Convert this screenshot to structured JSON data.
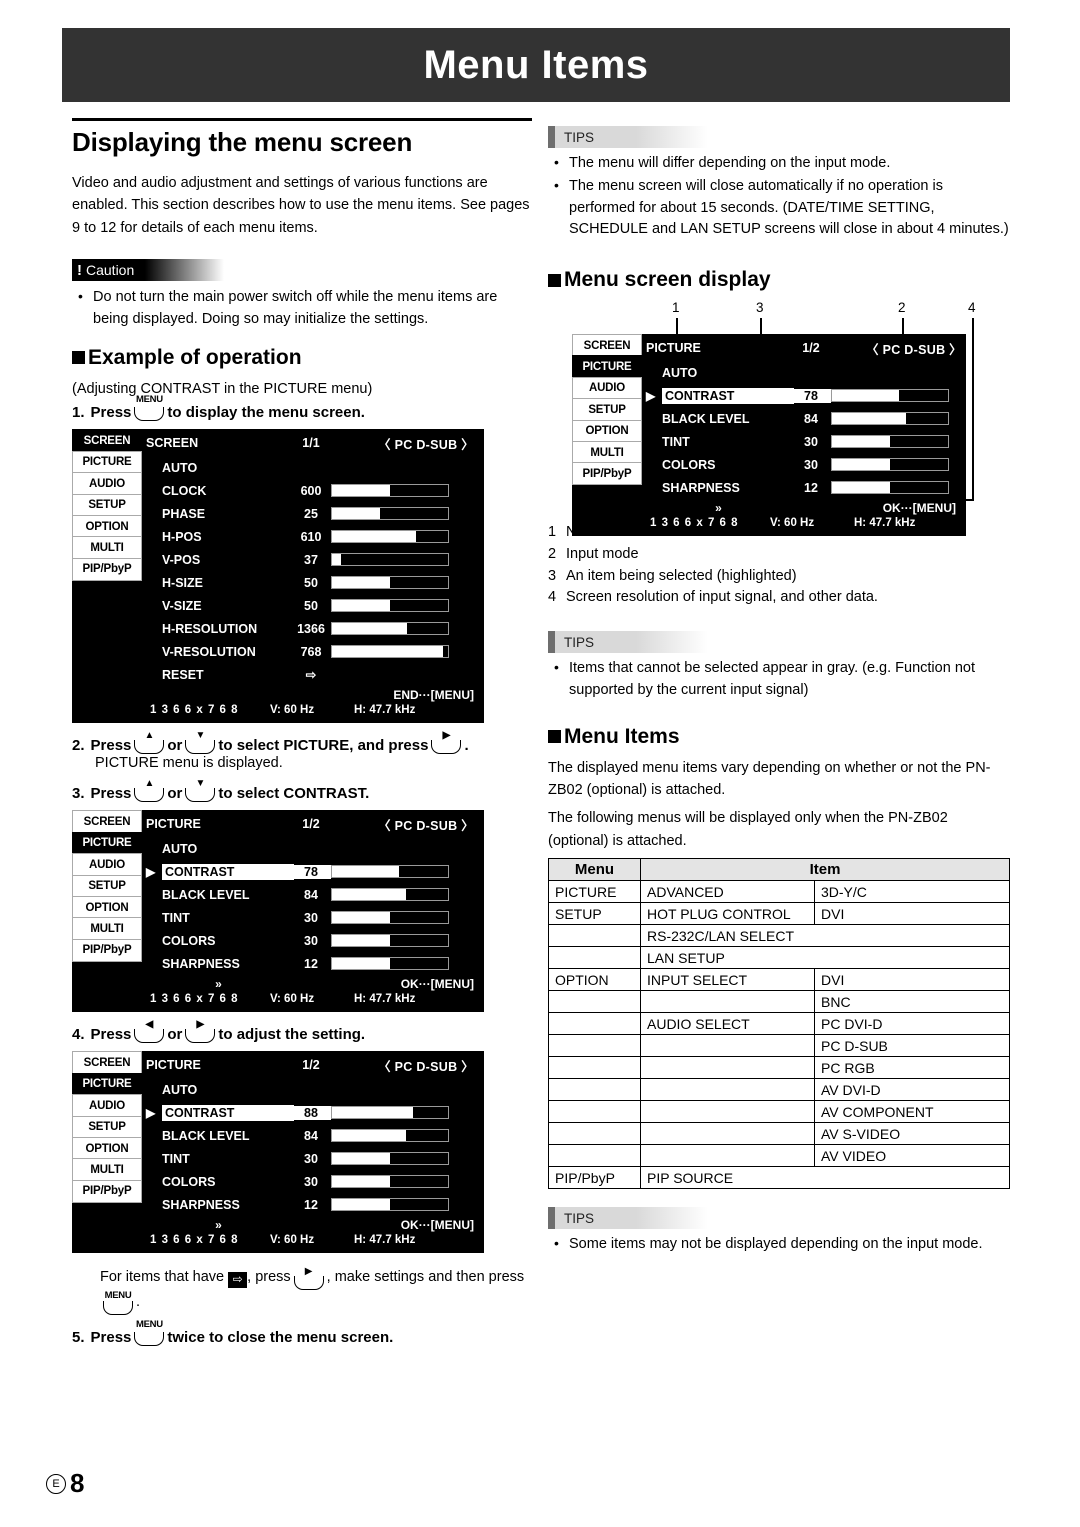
{
  "page": {
    "banner_title": "Menu Items",
    "footer_region": "E",
    "footer_page": "8"
  },
  "left": {
    "section_title": "Displaying the menu screen",
    "intro": "Video and audio adjustment and settings of various functions are enabled. This section describes how to use the menu items. See pages 9 to 12 for details of each menu items.",
    "caution": {
      "label": "Caution",
      "bullets": [
        "Do not turn the main power switch off while the menu items are being displayed. Doing so may initialize the settings."
      ]
    },
    "example_heading": "Example of operation",
    "example_sub": "(Adjusting CONTRAST in the PICTURE menu)",
    "step1": {
      "num": "1.",
      "a": "Press",
      "key": "MENU",
      "b": "to display the menu screen."
    },
    "step2": {
      "num": "2.",
      "a": "Press",
      "key1": "▲",
      "or": "or",
      "key2": "▼",
      "b": "to select PICTURE, and press",
      "key3": "▶",
      "b2": ".",
      "sub": "PICTURE menu is displayed."
    },
    "step3": {
      "num": "3.",
      "a": "Press",
      "key1": "▲",
      "or": "or",
      "key2": "▼",
      "b": "to select CONTRAST."
    },
    "step4": {
      "num": "4.",
      "a": "Press",
      "key1": "◀",
      "or": "or",
      "key2": "▶",
      "b": "to adjust the setting."
    },
    "note4": {
      "a": "For items that have",
      "icon": "⇨",
      "b": ", press",
      "key": "▶",
      "c": ", make settings and then press",
      "key2": "MENU",
      "d": "."
    },
    "step5": {
      "num": "5.",
      "a": "Press",
      "key": "MENU",
      "b": "twice to close the menu screen."
    }
  },
  "right": {
    "tips1": {
      "label": "TIPS",
      "bullets": [
        "The menu will differ depending on the input mode.",
        "The menu screen will close automatically if no operation is performed for about 15 seconds. (DATE/TIME SETTING, SCHEDULE and LAN SETUP screens will close in about 4 minutes.)"
      ]
    },
    "menu_screen_display_heading": "Menu screen display",
    "callouts": [
      "1",
      "3",
      "2",
      "4"
    ],
    "legend": [
      {
        "n": "1",
        "text": "Name of the menu"
      },
      {
        "n": "2",
        "text": "Input mode"
      },
      {
        "n": "3",
        "text": "An item being selected (highlighted)"
      },
      {
        "n": "4",
        "text": "Screen resolution of input signal, and other data."
      }
    ],
    "tips2": {
      "label": "TIPS",
      "bullets": [
        "Items that cannot be selected appear in gray. (e.g. Function not supported by the current input signal)"
      ]
    },
    "menu_items_heading": "Menu Items",
    "menu_items_p1": "The displayed menu items vary depending on whether or not the PN-ZB02 (optional) is attached.",
    "menu_items_p2": "The following menus will be displayed only when the PN-ZB02 (optional) is attached.",
    "table": {
      "headers": {
        "menu": "Menu",
        "item": "Item"
      },
      "rows": [
        {
          "menu": "PICTURE",
          "item": "ADVANCED",
          "value": "3D-Y/C",
          "span": false
        },
        {
          "menu": "SETUP",
          "item": "HOT PLUG CONTROL",
          "value": "DVI",
          "span": false
        },
        {
          "menu": "",
          "item": "RS-232C/LAN SELECT",
          "value": "",
          "span": true
        },
        {
          "menu": "",
          "item": "LAN SETUP",
          "value": "",
          "span": true
        },
        {
          "menu": "OPTION",
          "item": "INPUT SELECT",
          "value": "DVI",
          "span": false
        },
        {
          "menu": "",
          "item": "",
          "value": "BNC",
          "span": false
        },
        {
          "menu": "",
          "item": "AUDIO SELECT",
          "value": "PC DVI-D",
          "span": false
        },
        {
          "menu": "",
          "item": "",
          "value": "PC D-SUB",
          "span": false
        },
        {
          "menu": "",
          "item": "",
          "value": "PC RGB",
          "span": false
        },
        {
          "menu": "",
          "item": "",
          "value": "AV DVI-D",
          "span": false
        },
        {
          "menu": "",
          "item": "",
          "value": "AV COMPONENT",
          "span": false
        },
        {
          "menu": "",
          "item": "",
          "value": "AV S-VIDEO",
          "span": false
        },
        {
          "menu": "",
          "item": "",
          "value": "AV VIDEO",
          "span": false
        },
        {
          "menu": "PIP/PbyP",
          "item": "PIP SOURCE",
          "value": "",
          "span": true
        }
      ]
    },
    "tips3": {
      "label": "TIPS",
      "bullets": [
        "Some items may not be displayed depending on the input mode."
      ]
    }
  },
  "osd": {
    "tabs": [
      "SCREEN",
      "PICTURE",
      "AUDIO",
      "SETUP",
      "OPTION",
      "MULTI",
      "PIP/PbyP"
    ],
    "signal": {
      "resolution": "1 3 6 6 x 7 6 8",
      "vfreq": "V: 60 Hz",
      "hfreq": "H: 47.7 kHz"
    },
    "chevron": "»",
    "screen_menu": {
      "active_tab": "SCREEN",
      "name": "SCREEN",
      "page": "1/1",
      "input": "〈 PC D-SUB 〉",
      "hint": "END···[MENU]",
      "show_chevron": false,
      "rows": [
        {
          "label": "AUTO",
          "value": "",
          "bar": null,
          "selected": false,
          "arrow": false
        },
        {
          "label": "CLOCK",
          "value": "600",
          "bar": 50,
          "selected": false,
          "arrow": false
        },
        {
          "label": "PHASE",
          "value": "25",
          "bar": 41,
          "selected": false,
          "arrow": false
        },
        {
          "label": "H-POS",
          "value": "610",
          "bar": 72,
          "selected": false,
          "arrow": false
        },
        {
          "label": "V-POS",
          "value": "37",
          "bar": 8,
          "selected": false,
          "arrow": false
        },
        {
          "label": "H-SIZE",
          "value": "50",
          "bar": 50,
          "selected": false,
          "arrow": false
        },
        {
          "label": "V-SIZE",
          "value": "50",
          "bar": 50,
          "selected": false,
          "arrow": false
        },
        {
          "label": "H-RESOLUTION",
          "value": "1366",
          "bar": 65,
          "selected": false,
          "arrow": false
        },
        {
          "label": "V-RESOLUTION",
          "value": "768",
          "bar": 96,
          "selected": false,
          "arrow": false
        },
        {
          "label": "RESET",
          "value": "⇨",
          "bar": null,
          "selected": false,
          "arrow": true
        }
      ]
    },
    "picture_menu_78": {
      "active_tab": "PICTURE",
      "name": "PICTURE",
      "page": "1/2",
      "input": "〈 PC D-SUB 〉",
      "hint": "OK···[MENU]",
      "show_chevron": true,
      "rows": [
        {
          "label": "AUTO",
          "value": "",
          "bar": null,
          "selected": false,
          "arrow": false
        },
        {
          "label": "CONTRAST",
          "value": "78",
          "bar": 58,
          "selected": true,
          "arrow": false
        },
        {
          "label": "BLACK LEVEL",
          "value": "84",
          "bar": 64,
          "selected": false,
          "arrow": false
        },
        {
          "label": "TINT",
          "value": "30",
          "bar": 50,
          "selected": false,
          "arrow": false
        },
        {
          "label": "COLORS",
          "value": "30",
          "bar": 50,
          "selected": false,
          "arrow": false
        },
        {
          "label": "SHARPNESS",
          "value": "12",
          "bar": 50,
          "selected": false,
          "arrow": false
        }
      ]
    },
    "picture_menu_88": {
      "active_tab": "PICTURE",
      "name": "PICTURE",
      "page": "1/2",
      "input": "〈 PC D-SUB 〉",
      "hint": "OK···[MENU]",
      "show_chevron": true,
      "rows": [
        {
          "label": "AUTO",
          "value": "",
          "bar": null,
          "selected": false,
          "arrow": false
        },
        {
          "label": "CONTRAST",
          "value": "88",
          "bar": 70,
          "selected": true,
          "arrow": false
        },
        {
          "label": "BLACK LEVEL",
          "value": "84",
          "bar": 64,
          "selected": false,
          "arrow": false
        },
        {
          "label": "TINT",
          "value": "30",
          "bar": 50,
          "selected": false,
          "arrow": false
        },
        {
          "label": "COLORS",
          "value": "30",
          "bar": 50,
          "selected": false,
          "arrow": false
        },
        {
          "label": "SHARPNESS",
          "value": "12",
          "bar": 50,
          "selected": false,
          "arrow": false
        }
      ]
    },
    "picture_menu_callout": {
      "active_tab": "PICTURE",
      "name": "PICTURE",
      "page": "1/2",
      "input": "〈 PC D-SUB 〉",
      "hint": "OK···[MENU]",
      "show_chevron": true,
      "rows": [
        {
          "label": "AUTO",
          "value": "",
          "bar": null,
          "selected": false,
          "arrow": false
        },
        {
          "label": "CONTRAST",
          "value": "78",
          "bar": 58,
          "selected": true,
          "arrow": false
        },
        {
          "label": "BLACK LEVEL",
          "value": "84",
          "bar": 64,
          "selected": false,
          "arrow": false
        },
        {
          "label": "TINT",
          "value": "30",
          "bar": 50,
          "selected": false,
          "arrow": false
        },
        {
          "label": "COLORS",
          "value": "30",
          "bar": 50,
          "selected": false,
          "arrow": false
        },
        {
          "label": "SHARPNESS",
          "value": "12",
          "bar": 50,
          "selected": false,
          "arrow": false
        }
      ]
    }
  }
}
